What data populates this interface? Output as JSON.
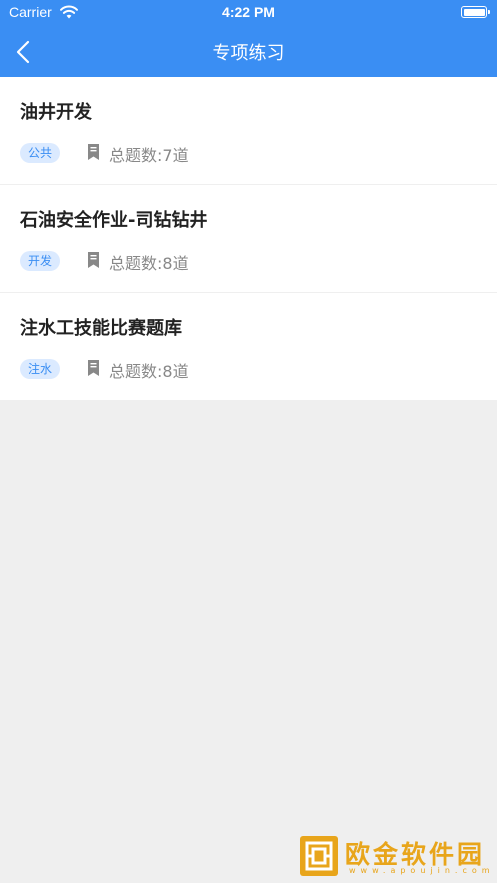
{
  "status_bar": {
    "carrier": "Carrier",
    "time": "4:22 PM"
  },
  "nav": {
    "title": "专项练习",
    "back_icon": "chevron-left-icon"
  },
  "items": [
    {
      "title": "油井开发",
      "tag": "公共",
      "count_label": "总题数:7道"
    },
    {
      "title": "石油安全作业-司钻钻井",
      "tag": "开发",
      "count_label": "总题数:8道"
    },
    {
      "title": "注水工技能比赛题库",
      "tag": "注水",
      "count_label": "总题数:8道"
    }
  ],
  "watermark": {
    "text": "欧金软件园",
    "url": "www.apoujin.com"
  },
  "colors": {
    "accent": "#3a8ef3",
    "tag_bg": "#dbeaff",
    "background": "#efefef",
    "watermark": "#e8a51b"
  }
}
